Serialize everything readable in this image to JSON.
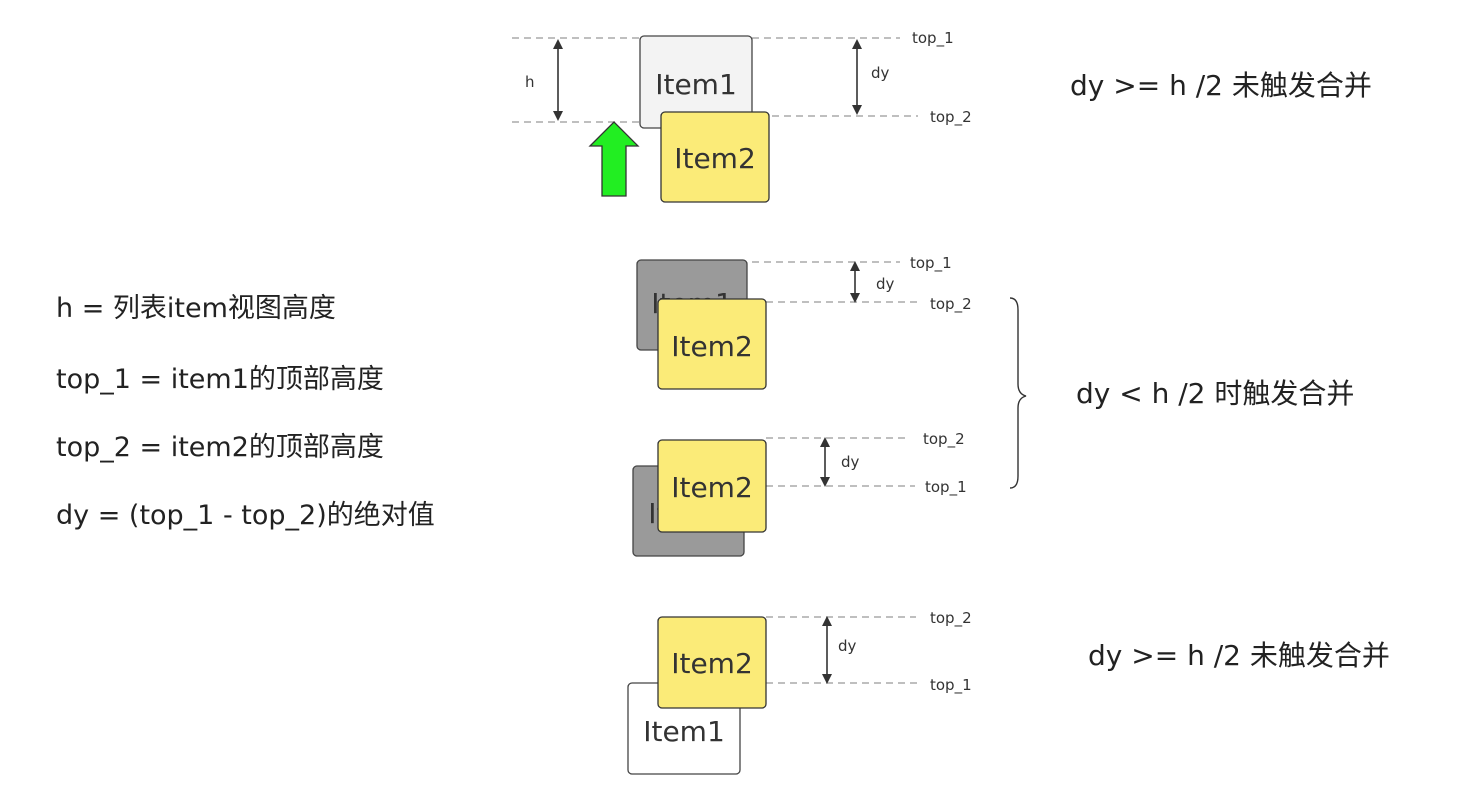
{
  "definitions": [
    "h = 列表item视图高度",
    "top_1 = item1的顶部高度",
    "top_2 = item2的顶部高度",
    "dy = (top_1 - top_2)的绝对值"
  ],
  "scenarios": [
    {
      "statement": "dy >= h /2 未触发合并",
      "item1_label": "Item1",
      "item2_label": "Item2",
      "top1_label": "top_1",
      "top2_label": "top_2",
      "dy_label": "dy",
      "h_label": "h"
    },
    {
      "statement": "dy < h /2 时触发合并",
      "item1_label": "Item1",
      "item2_label": "Item2",
      "top1_label": "top_1",
      "top2_label": "top_2",
      "dy_label": "dy"
    },
    {
      "statement": "dy >= h /2 未触发合并",
      "item1_label": "Item1",
      "item2_label": "Item2",
      "top1_label": "top_1",
      "top2_label": "top_2",
      "dy_label": "dy"
    }
  ],
  "colors": {
    "item2_fill": "#fbeb78",
    "item1_light_fill": "#f3f3f3",
    "item1_gray_fill": "#9a9a9a",
    "arrow_fill": "#22ee22",
    "stroke": "#333333",
    "dashed": "#999999"
  }
}
